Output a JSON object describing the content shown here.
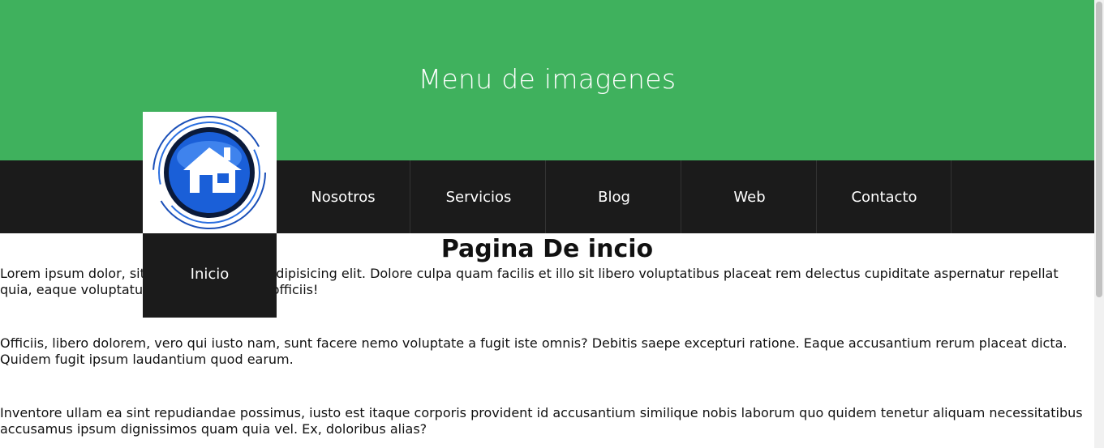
{
  "header": {
    "title": "Menu de imagenes"
  },
  "nav": {
    "items": [
      {
        "label": "Inicio",
        "icon": "home-icon"
      },
      {
        "label": "Nosotros"
      },
      {
        "label": "Servicios"
      },
      {
        "label": "Blog"
      },
      {
        "label": "Web"
      },
      {
        "label": "Contacto"
      }
    ]
  },
  "content": {
    "title": "Pagina De incio",
    "paragraphs": [
      "Lorem ipsum dolor, sit amet consectetur adipisicing elit. Dolore culpa quam facilis et illo sit libero voluptatibus placeat rem delectus cupiditate aspernatur repellat quia, eaque voluptatum debitis non iusto officiis!",
      "Officiis, libero dolorem, vero qui iusto nam, sunt facere nemo voluptate a fugit iste omnis? Debitis saepe excepturi ratione. Eaque accusantium rerum placeat dicta. Quidem fugit ipsum laudantium quod earum.",
      "Inventore ullam ea sint repudiandae possimus, iusto est itaque corporis provident id accusantium similique nobis laborum quo quidem tenetur aliquam necessitatibus accusamus ipsum dignissimos quam quia vel. Ex, doloribus alias?"
    ]
  },
  "colors": {
    "header_bg": "#3fb15d",
    "nav_bg": "#1b1b1b",
    "icon_blue": "#1a5fd8"
  }
}
